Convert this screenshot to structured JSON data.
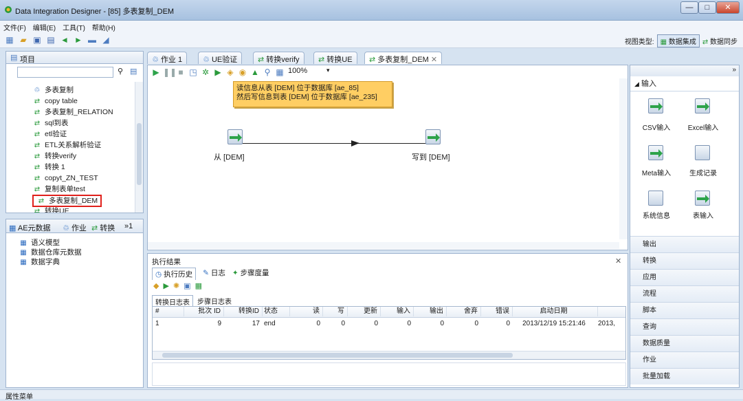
{
  "window": {
    "title": "Data Integration Designer - [85] 多表复制_DEM",
    "min": "—",
    "max": "□",
    "close": "✕"
  },
  "menu": [
    "文件(F)",
    "编辑(E)",
    "工具(T)",
    "帮助(H)"
  ],
  "viewtype": {
    "label": "视图类型:",
    "selected": "数据集成",
    "other": "数据同步"
  },
  "project": {
    "tab": "项目",
    "tree": [
      {
        "label": "多表复制",
        "icon": "job"
      },
      {
        "label": "copy table",
        "icon": "trans"
      },
      {
        "label": "多表复制_RELATION",
        "icon": "trans"
      },
      {
        "label": "sql到表",
        "icon": "trans"
      },
      {
        "label": "etl验证",
        "icon": "trans"
      },
      {
        "label": "ETL关系解析验证",
        "icon": "trans"
      },
      {
        "label": "转换verify",
        "icon": "trans"
      },
      {
        "label": "转换 1",
        "icon": "trans"
      },
      {
        "label": "copyt_ZN_TEST",
        "icon": "trans"
      },
      {
        "label": "复制表单test",
        "icon": "trans"
      },
      {
        "label": "多表复制_DEM",
        "icon": "trans"
      },
      {
        "label": "转换UE",
        "icon": "trans"
      }
    ]
  },
  "meta": {
    "tabs": [
      "AE元数据",
      "作业",
      "转换",
      "»1"
    ],
    "items": [
      "语义模型",
      "数据仓库元数据",
      "数据字典"
    ]
  },
  "editor": {
    "tabs": [
      "作业 1",
      "UE验证",
      "转换verify",
      "转换UE",
      "多表复制_DEM"
    ],
    "zoom": "100%",
    "note_line1": "读信息从表 [DEM] 位于数据库 [ae_85]",
    "note_line2": "然后写信息到表 [DEM] 位于数据库 [ae_235]",
    "step_from": "从 [DEM]",
    "step_to": "写到 [DEM]"
  },
  "results": {
    "title": "执行结果",
    "tabs": [
      "执行历史",
      "日志",
      "步骤度量"
    ],
    "subtabs": [
      "转换日志表",
      "步骤日志表"
    ],
    "columns": [
      "#",
      "批次 ID",
      "转换ID",
      "状态",
      "读",
      "写",
      "更新",
      "输入",
      "输出",
      "舍弃",
      "错误",
      "启动日期"
    ],
    "rows": [
      [
        "1",
        "9",
        "17",
        "end",
        "0",
        "0",
        "0",
        "0",
        "0",
        "0",
        "0",
        "2013/12/19 15:21:46",
        "2013,"
      ]
    ]
  },
  "palette": {
    "header": "输入",
    "items": [
      "CSV输入",
      "Excel输入",
      "Meta输入",
      "生成记录",
      "系统信息",
      "表输入"
    ],
    "categories": [
      "输出",
      "转换",
      "应用",
      "流程",
      "脚本",
      "查询",
      "数据质量",
      "作业",
      "批量加载"
    ]
  },
  "status": "属性菜单"
}
